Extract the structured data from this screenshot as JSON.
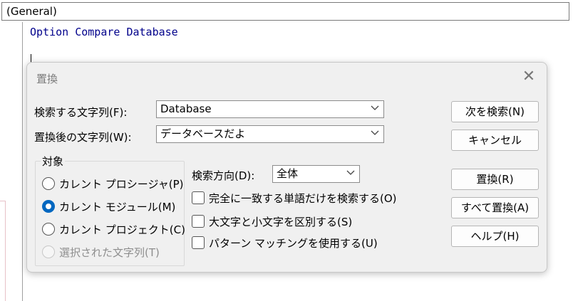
{
  "editor": {
    "procedure_combo": "(General)",
    "code_line": "Option Compare Database"
  },
  "dialog": {
    "title": "置換",
    "close_glyph": "✕",
    "find_label": "検索する文字列(F):",
    "find_value": "Database",
    "replace_label": "置換後の文字列(W):",
    "replace_value": "データベースだよ",
    "scope_group_title": "対象",
    "scope_options": [
      {
        "label": "カレント プロシージャ(P)",
        "checked": false,
        "disabled": false
      },
      {
        "label": "カレント モジュール(M)",
        "checked": true,
        "disabled": false
      },
      {
        "label": "カレント プロジェクト(C)",
        "checked": false,
        "disabled": false
      },
      {
        "label": "選択された文字列(T)",
        "checked": false,
        "disabled": true
      }
    ],
    "direction_label": "検索方向(D):",
    "direction_value": "全体",
    "options": [
      {
        "label": "完全に一致する単語だけを検索する(O)",
        "checked": false
      },
      {
        "label": "大文字と小文字を区別する(S)",
        "checked": false
      },
      {
        "label": "パターン マッチングを使用する(U)",
        "checked": false
      }
    ],
    "buttons": {
      "find_next": "次を検索(N)",
      "cancel": "キャンセル",
      "replace": "置換(R)",
      "replace_all": "すべて置換(A)",
      "help": "ヘルプ(H)"
    }
  },
  "colors": {
    "code_keyword": "#00008b",
    "radio_accent": "#0067c0",
    "dialog_bg": "#f0f0f0"
  }
}
